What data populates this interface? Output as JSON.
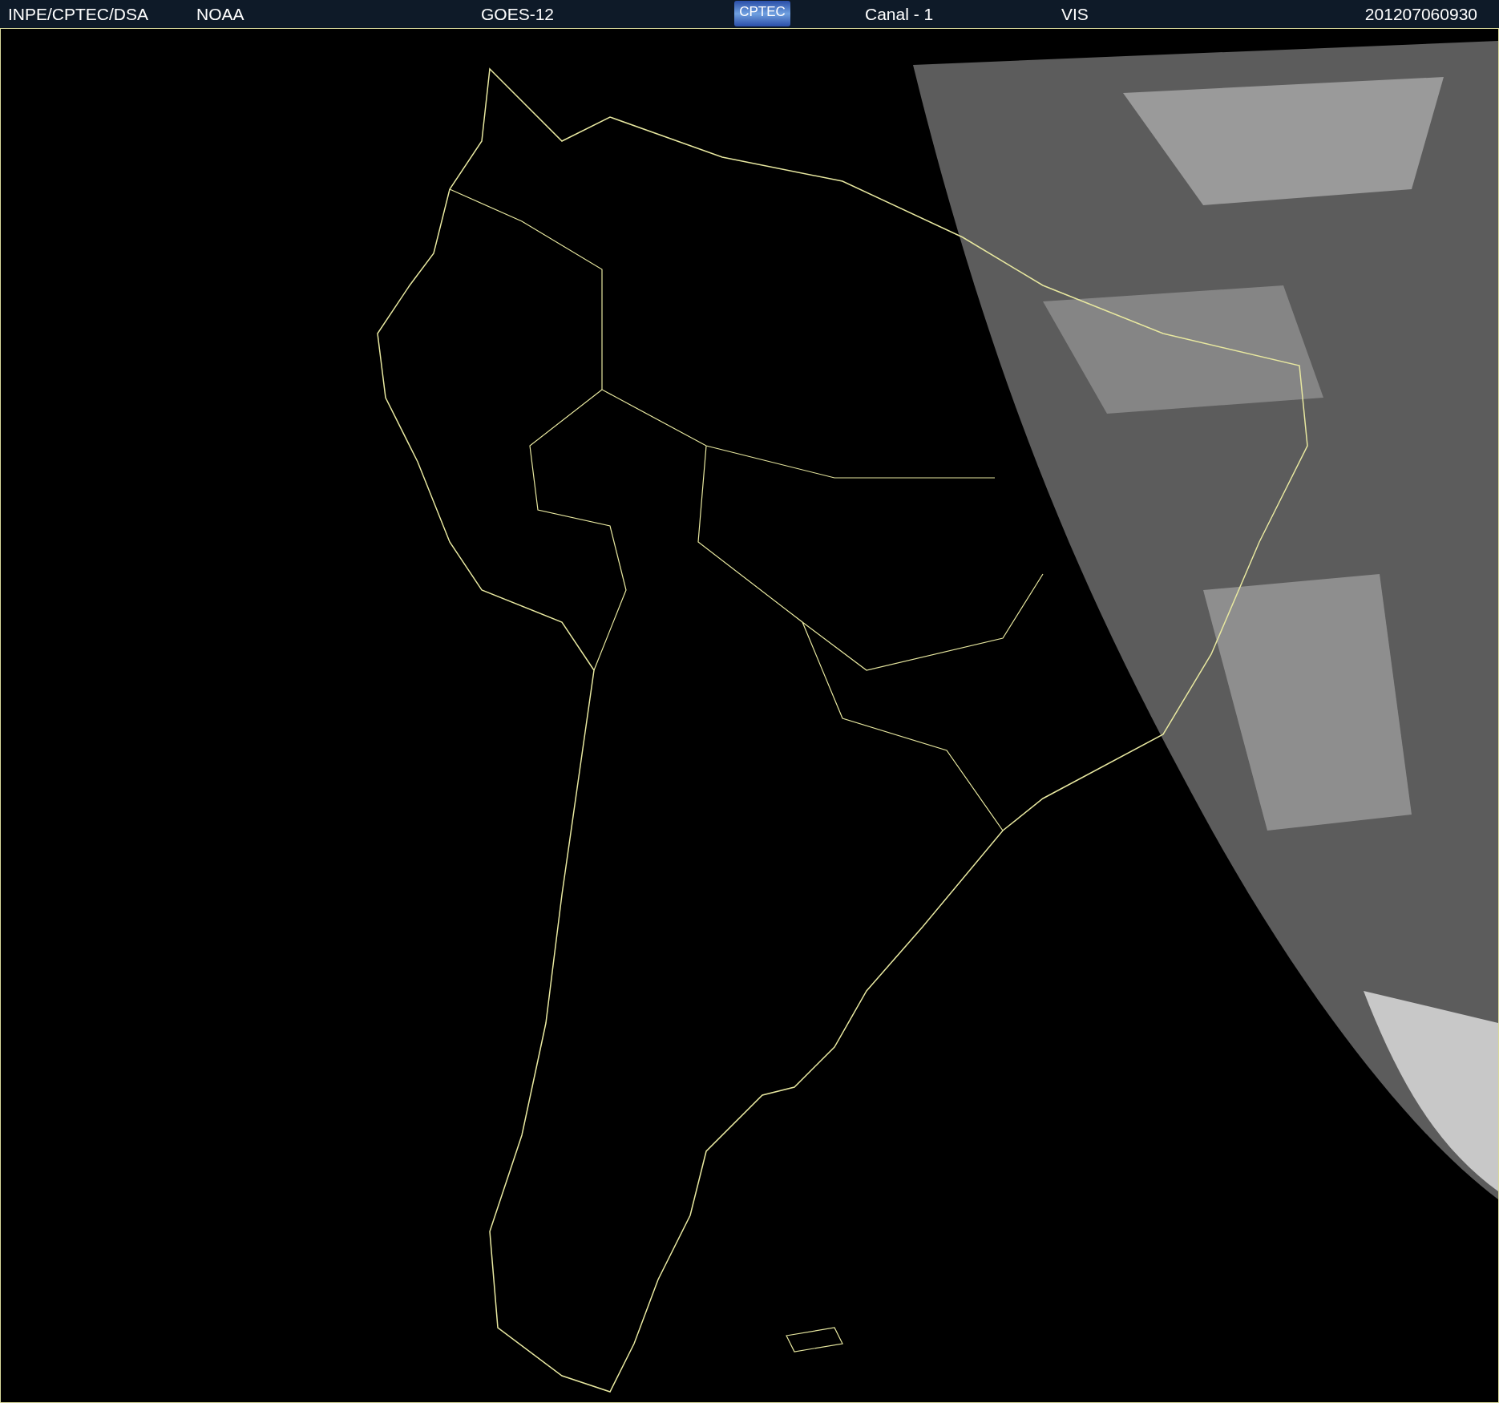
{
  "header": {
    "source": "INPE/CPTEC/DSA",
    "agency": "NOAA",
    "satellite": "GOES-12",
    "logo": "CPTEC",
    "channel": "Canal - 1",
    "band": "VIS",
    "timestamp": "201207060930"
  }
}
